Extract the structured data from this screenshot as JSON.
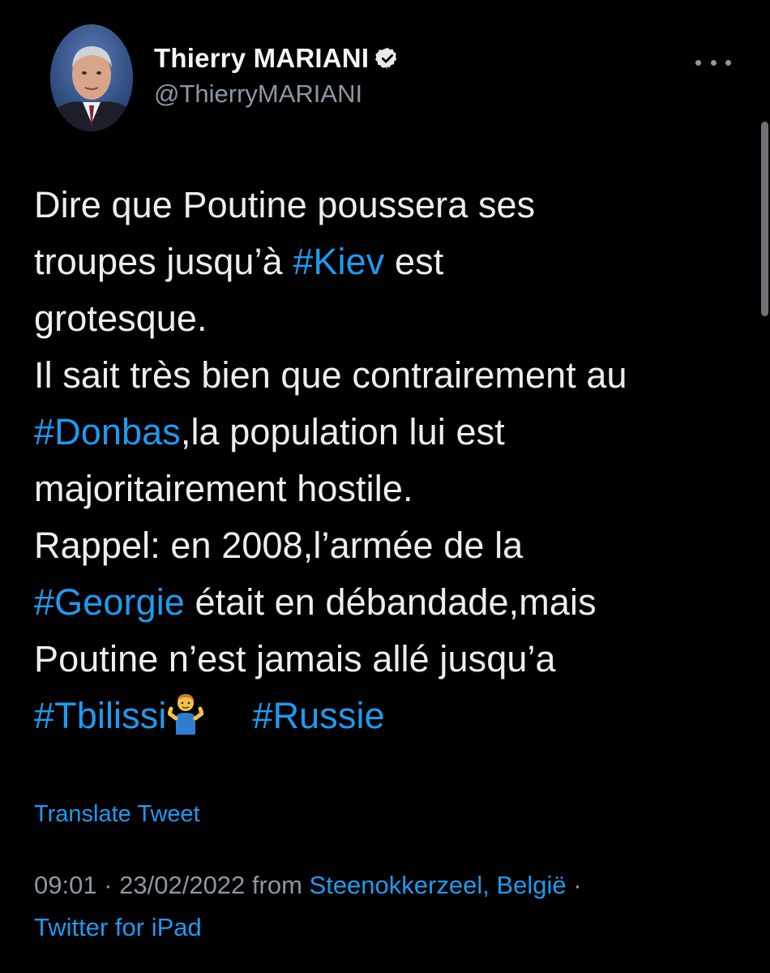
{
  "author": {
    "display_name": "Thierry MARIANI",
    "handle": "@ThierryMARIANI",
    "verified": true
  },
  "icons": {
    "verified": "verified-badge-icon",
    "more": "more-options-icon",
    "emoji": "person-shrugging-emoji"
  },
  "tweet": {
    "line1": "Dire que Poutine poussera ses",
    "line2_pre": "troupes jusqu’à ",
    "line2_tag": "#Kiev",
    "line2_post": " est",
    "line3": "grotesque.",
    "line4": "Il sait très bien que contrairement au",
    "line5_tag": "#Donbas",
    "line5_post": ",la population lui est",
    "line6": "majoritairement hostile.",
    "line7": "Rappel: en 2008,l’armée de la",
    "line8_tag": "#Georgie",
    "line8_post": " était en débandade,mais",
    "line9": "Poutine n’est jamais allé jusqu’a",
    "line10_tag1": "#Tbilissi",
    "line10_tag2": "#Russie"
  },
  "translate_label": "Translate Tweet",
  "meta": {
    "time": "09:01",
    "separator": " · ",
    "date": "23/02/2022",
    "from": " from ",
    "location": "Steenokkerzeel, België",
    "separator2": " ·",
    "source": "Twitter for iPad"
  },
  "colors": {
    "background": "#000000",
    "text": "#e7e9ea",
    "secondary": "#8b98a5",
    "link": "#1d9bf0"
  }
}
